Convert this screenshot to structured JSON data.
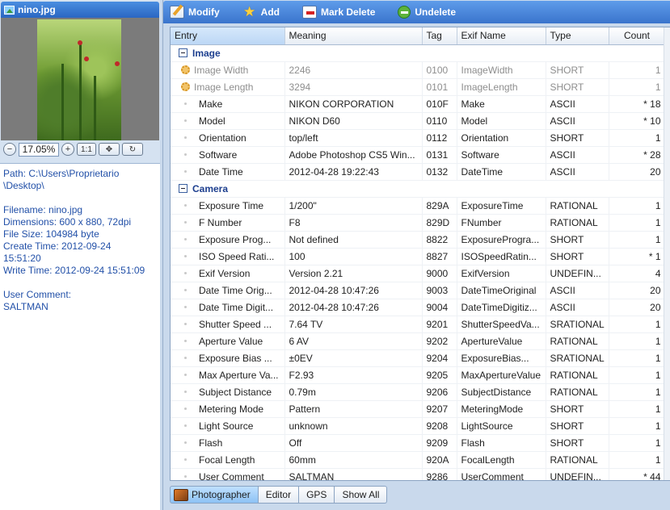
{
  "thumbnail": {
    "filename": "nino.jpg",
    "zoom": "17.05%",
    "ratio_label": "1:1"
  },
  "info": {
    "path_line1": "Path: C:\\Users\\Proprietario",
    "path_line2": "\\Desktop\\",
    "filename": "Filename: nino.jpg",
    "dimensions": "Dimensions: 600 x 880, 72dpi",
    "file_size": "File Size: 104984 byte",
    "create_time_line1": "Create Time: 2012-09-24",
    "create_time_line2": "15:51:20",
    "write_time": "Write Time: 2012-09-24 15:51:09",
    "user_comment_label": "User Comment:",
    "user_comment_value": "SALTMAN"
  },
  "toolbar": {
    "modify": "Modify",
    "add": "Add",
    "mark_delete": "Mark Delete",
    "undelete": "Undelete"
  },
  "columns": {
    "entry": "Entry",
    "meaning": "Meaning",
    "tag": "Tag",
    "exif_name": "Exif Name",
    "type": "Type",
    "count": "Count"
  },
  "groups": {
    "image": "Image",
    "camera": "Camera"
  },
  "image_rows": [
    {
      "entry": "Image Width",
      "meaning": "2246",
      "tag": "0100",
      "exif_name": "ImageWidth",
      "type": "SHORT",
      "count": "1",
      "dim": true,
      "gear": true
    },
    {
      "entry": "Image Length",
      "meaning": "3294",
      "tag": "0101",
      "exif_name": "ImageLength",
      "type": "SHORT",
      "count": "1",
      "dim": true,
      "gear": true
    },
    {
      "entry": "Make",
      "meaning": "NIKON CORPORATION",
      "tag": "010F",
      "exif_name": "Make",
      "type": "ASCII",
      "count": "* 18"
    },
    {
      "entry": "Model",
      "meaning": "NIKON D60",
      "tag": "0110",
      "exif_name": "Model",
      "type": "ASCII",
      "count": "* 10"
    },
    {
      "entry": "Orientation",
      "meaning": "top/left",
      "tag": "0112",
      "exif_name": "Orientation",
      "type": "SHORT",
      "count": "1"
    },
    {
      "entry": "Software",
      "meaning": "Adobe Photoshop CS5 Win...",
      "tag": "0131",
      "exif_name": "Software",
      "type": "ASCII",
      "count": "* 28"
    },
    {
      "entry": "Date Time",
      "meaning": "2012-04-28 19:22:43",
      "tag": "0132",
      "exif_name": "DateTime",
      "type": "ASCII",
      "count": "20"
    }
  ],
  "camera_rows": [
    {
      "entry": "Exposure Time",
      "meaning": "1/200\"",
      "tag": "829A",
      "exif_name": "ExposureTime",
      "type": "RATIONAL",
      "count": "1"
    },
    {
      "entry": "F Number",
      "meaning": "F8",
      "tag": "829D",
      "exif_name": "FNumber",
      "type": "RATIONAL",
      "count": "1"
    },
    {
      "entry": "Exposure Prog...",
      "meaning": "Not defined",
      "tag": "8822",
      "exif_name": "ExposureProgra...",
      "type": "SHORT",
      "count": "1"
    },
    {
      "entry": "ISO Speed Rati...",
      "meaning": "100",
      "tag": "8827",
      "exif_name": "ISOSpeedRatin...",
      "type": "SHORT",
      "count": "* 1"
    },
    {
      "entry": "Exif Version",
      "meaning": "Version 2.21",
      "tag": "9000",
      "exif_name": "ExifVersion",
      "type": "UNDEFIN...",
      "count": "4"
    },
    {
      "entry": "Date Time Orig...",
      "meaning": "2012-04-28 10:47:26",
      "tag": "9003",
      "exif_name": "DateTimeOriginal",
      "type": "ASCII",
      "count": "20"
    },
    {
      "entry": "Date Time Digit...",
      "meaning": "2012-04-28 10:47:26",
      "tag": "9004",
      "exif_name": "DateTimeDigitiz...",
      "type": "ASCII",
      "count": "20"
    },
    {
      "entry": "Shutter Speed ...",
      "meaning": "7.64 TV",
      "tag": "9201",
      "exif_name": "ShutterSpeedVa...",
      "type": "SRATIONAL",
      "count": "1"
    },
    {
      "entry": "Aperture Value",
      "meaning": "6 AV",
      "tag": "9202",
      "exif_name": "ApertureValue",
      "type": "RATIONAL",
      "count": "1"
    },
    {
      "entry": "Exposure Bias ...",
      "meaning": "±0EV",
      "tag": "9204",
      "exif_name": "ExposureBias...",
      "type": "SRATIONAL",
      "count": "1"
    },
    {
      "entry": "Max Aperture Va...",
      "meaning": "F2.93",
      "tag": "9205",
      "exif_name": "MaxApertureValue",
      "type": "RATIONAL",
      "count": "1"
    },
    {
      "entry": "Subject Distance",
      "meaning": "0.79m",
      "tag": "9206",
      "exif_name": "SubjectDistance",
      "type": "RATIONAL",
      "count": "1"
    },
    {
      "entry": "Metering Mode",
      "meaning": "Pattern",
      "tag": "9207",
      "exif_name": "MeteringMode",
      "type": "SHORT",
      "count": "1"
    },
    {
      "entry": "Light Source",
      "meaning": "unknown",
      "tag": "9208",
      "exif_name": "LightSource",
      "type": "SHORT",
      "count": "1"
    },
    {
      "entry": "Flash",
      "meaning": "Off",
      "tag": "9209",
      "exif_name": "Flash",
      "type": "SHORT",
      "count": "1"
    },
    {
      "entry": "Focal Length",
      "meaning": "60mm",
      "tag": "920A",
      "exif_name": "FocalLength",
      "type": "RATIONAL",
      "count": "1"
    },
    {
      "entry": "User Comment",
      "meaning": "SALTMAN",
      "tag": "9286",
      "exif_name": "UserComment",
      "type": "UNDEFIN...",
      "count": "* 44"
    }
  ],
  "tabs": [
    {
      "label": "Photographer",
      "active": true
    },
    {
      "label": "Editor",
      "active": false
    },
    {
      "label": "GPS",
      "active": false
    },
    {
      "label": "Show All",
      "active": false
    }
  ]
}
